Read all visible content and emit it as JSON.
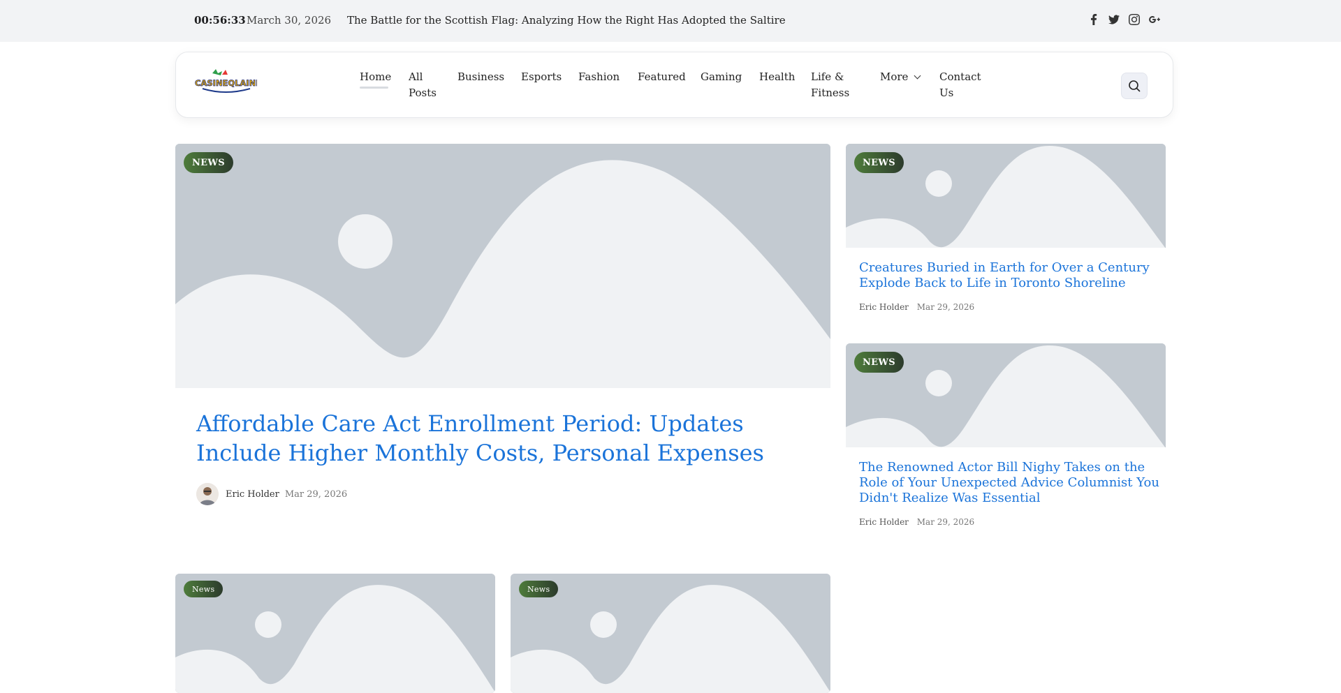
{
  "topbar": {
    "time": "00:56:33",
    "date": "March 30, 2026",
    "ticker": "The Battle for the Scottish Flag: Analyzing How the Right Has Adopted the Saltire",
    "social_icons": [
      "facebook-icon",
      "twitter-icon",
      "instagram-icon",
      "google-plus-icon"
    ]
  },
  "header": {
    "logo_text": "CASINEQLAINE",
    "nav": [
      {
        "label": "Home"
      },
      {
        "label": "All Posts"
      },
      {
        "label": "Business"
      },
      {
        "label": "Esports"
      },
      {
        "label": "Fashion"
      },
      {
        "label": "Featured"
      },
      {
        "label": "Gaming"
      },
      {
        "label": "Health"
      },
      {
        "label": "Life & Fitness"
      },
      {
        "label": "More"
      },
      {
        "label": "Contact Us"
      }
    ],
    "search_icon": "search-icon"
  },
  "featured": {
    "badge": "NEWS",
    "title": "Affordable Care Act Enrollment Period: Updates Include Higher Monthly Costs, Personal Expenses",
    "author": "Eric Holder",
    "date": "Mar 29, 2026"
  },
  "side_posts": [
    {
      "badge": "NEWS",
      "title": "Creatures Buried in Earth for Over a Century Explode Back to Life in Toronto Shoreline",
      "author": "Eric Holder",
      "date": "Mar 29, 2026"
    },
    {
      "badge": "NEWS",
      "title": "The Renowned Actor Bill Nighy Takes on the Role of Your Unexpected Advice Columnist You Didn't Realize Was Essential",
      "author": "Eric Holder",
      "date": "Mar 29, 2026"
    }
  ],
  "bottom_posts": [
    {
      "badge": "News"
    },
    {
      "badge": "News"
    }
  ],
  "colors": {
    "accent_link": "#1a73d9",
    "badge_green": "#4e7c3b",
    "topbar_bg": "#f2f3f5",
    "placeholder_bg": "#c3cad1"
  }
}
